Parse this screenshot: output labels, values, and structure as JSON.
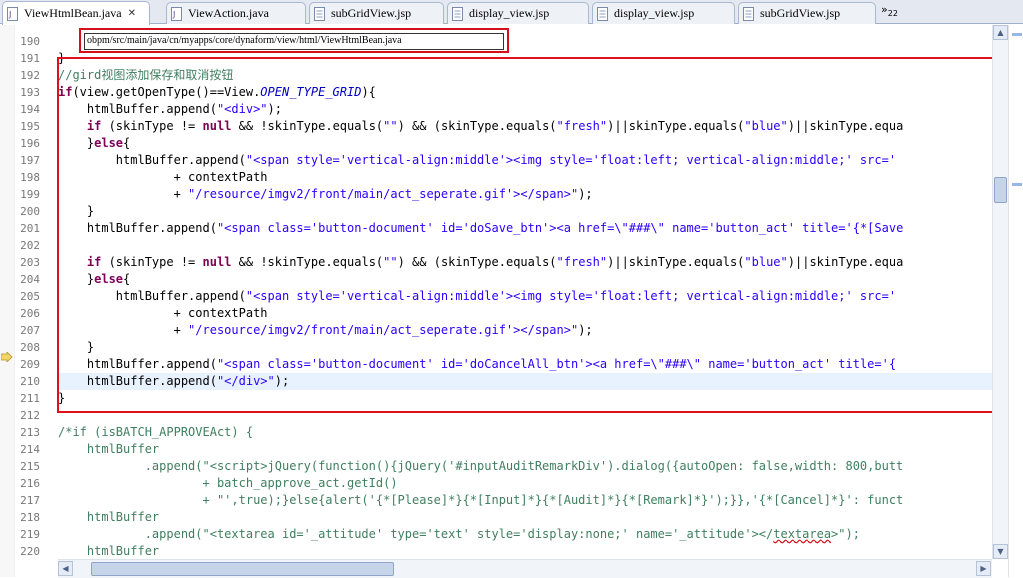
{
  "tabs": [
    {
      "label": "ViewHtmlBean.java",
      "active": true,
      "icon": "java-file-icon"
    },
    {
      "label": "ViewAction.java",
      "active": false,
      "icon": "java-file-icon"
    },
    {
      "label": "subGridView.jsp",
      "active": false,
      "icon": "jsp-file-icon"
    },
    {
      "label": "display_view.jsp",
      "active": false,
      "icon": "jsp-file-icon"
    },
    {
      "label": "display_view.jsp",
      "active": false,
      "icon": "jsp-file-icon"
    },
    {
      "label": "subGridView.jsp",
      "active": false,
      "icon": "jsp-file-icon"
    }
  ],
  "overflow": {
    "chevron": "»",
    "count": "22"
  },
  "file_path_tooltip": "obpm/src/main/java/cn/myapps/core/dynaform/view/html/ViewHtmlBean.java",
  "lines": [
    {
      "n": "190",
      "segs": []
    },
    {
      "n": "191",
      "segs": [
        {
          "t": "}"
        }
      ]
    },
    {
      "n": "192",
      "segs": [
        {
          "t": "//gird视图添加保存和取消按钮",
          "c": "cmt"
        }
      ]
    },
    {
      "n": "193",
      "segs": [
        {
          "t": "if",
          "c": "kw"
        },
        {
          "t": "(view.getOpenType()==View."
        },
        {
          "t": "OPEN_TYPE_GRID",
          "c": "ital"
        },
        {
          "t": "){"
        }
      ]
    },
    {
      "n": "194",
      "segs": [
        {
          "t": "    htmlBuffer.append("
        },
        {
          "t": "\"<div>\"",
          "c": "str"
        },
        {
          "t": ");"
        }
      ]
    },
    {
      "n": "195",
      "segs": [
        {
          "t": "    "
        },
        {
          "t": "if",
          "c": "kw"
        },
        {
          "t": " (skinType != "
        },
        {
          "t": "null",
          "c": "kw"
        },
        {
          "t": " && !skinType.equals("
        },
        {
          "t": "\"\"",
          "c": "str"
        },
        {
          "t": ") && (skinType.equals("
        },
        {
          "t": "\"fresh\"",
          "c": "str"
        },
        {
          "t": ")||skinType.equals("
        },
        {
          "t": "\"blue\"",
          "c": "str"
        },
        {
          "t": ")||skinType.equa"
        }
      ]
    },
    {
      "n": "196",
      "segs": [
        {
          "t": "    }"
        },
        {
          "t": "else",
          "c": "kw"
        },
        {
          "t": "{"
        }
      ]
    },
    {
      "n": "197",
      "segs": [
        {
          "t": "        htmlBuffer.append("
        },
        {
          "t": "\"<span style='vertical-align:middle'><img style='float:left; vertical-align:middle;' src='",
          "c": "str"
        }
      ]
    },
    {
      "n": "198",
      "segs": [
        {
          "t": "                + contextPath"
        }
      ]
    },
    {
      "n": "199",
      "segs": [
        {
          "t": "                + "
        },
        {
          "t": "\"/resource/imgv2/front/main/act_seperate.gif'></span>\"",
          "c": "str"
        },
        {
          "t": ");"
        }
      ]
    },
    {
      "n": "200",
      "segs": [
        {
          "t": "    }"
        }
      ]
    },
    {
      "n": "201",
      "segs": [
        {
          "t": "    htmlBuffer.append("
        },
        {
          "t": "\"<span class='button-document' id='doSave_btn'><a href=\\\"###\\\" name='button_act' title='{*[Save",
          "c": "str"
        }
      ]
    },
    {
      "n": "202",
      "segs": []
    },
    {
      "n": "203",
      "segs": [
        {
          "t": "    "
        },
        {
          "t": "if",
          "c": "kw"
        },
        {
          "t": " (skinType != "
        },
        {
          "t": "null",
          "c": "kw"
        },
        {
          "t": " && !skinType.equals("
        },
        {
          "t": "\"\"",
          "c": "str"
        },
        {
          "t": ") && (skinType.equals("
        },
        {
          "t": "\"fresh\"",
          "c": "str"
        },
        {
          "t": ")||skinType.equals("
        },
        {
          "t": "\"blue\"",
          "c": "str"
        },
        {
          "t": ")||skinType.equa"
        }
      ]
    },
    {
      "n": "204",
      "segs": [
        {
          "t": "    }"
        },
        {
          "t": "else",
          "c": "kw"
        },
        {
          "t": "{"
        }
      ]
    },
    {
      "n": "205",
      "segs": [
        {
          "t": "        htmlBuffer.append("
        },
        {
          "t": "\"<span style='vertical-align:middle'><img style='float:left; vertical-align:middle;' src='",
          "c": "str"
        }
      ]
    },
    {
      "n": "206",
      "segs": [
        {
          "t": "                + contextPath"
        }
      ]
    },
    {
      "n": "207",
      "segs": [
        {
          "t": "                + "
        },
        {
          "t": "\"/resource/imgv2/front/main/act_seperate.gif'></span>\"",
          "c": "str"
        },
        {
          "t": ");"
        }
      ]
    },
    {
      "n": "208",
      "segs": [
        {
          "t": "    }"
        }
      ]
    },
    {
      "n": "209",
      "segs": [
        {
          "t": "    htmlBuffer.append("
        },
        {
          "t": "\"<span class='button-document' id='doCancelAll_btn'><a href=\\\"###\\\" name='button_act' title='{",
          "c": "str"
        }
      ]
    },
    {
      "n": "210",
      "segs": [
        {
          "t": "    htmlBuffer.append("
        },
        {
          "t": "\"</div>\"",
          "c": "str"
        },
        {
          "t": ");"
        }
      ]
    },
    {
      "n": "211",
      "segs": [
        {
          "t": "}"
        }
      ]
    },
    {
      "n": "212",
      "segs": []
    },
    {
      "n": "213",
      "segs": [
        {
          "t": "/*if (isBATCH_APPROVEAct) {",
          "c": "cmt"
        }
      ]
    },
    {
      "n": "214",
      "segs": [
        {
          "t": "    htmlBuffer",
          "c": "cmt"
        }
      ]
    },
    {
      "n": "215",
      "segs": [
        {
          "t": "            .append(\"<script>jQuery(function(){jQuery('#inputAuditRemarkDiv').dialog({autoOpen: false,width: 800,butt",
          "c": "cmt"
        }
      ]
    },
    {
      "n": "216",
      "segs": [
        {
          "t": "                    + batch_approve_act.getId()",
          "c": "cmt"
        }
      ]
    },
    {
      "n": "217",
      "segs": [
        {
          "t": "                    + \"',true);}else{alert('{*[Please]*}{*[Input]*}{*[Audit]*}{*[Remark]*}');}},'{*[Cancel]*}': funct",
          "c": "cmt"
        }
      ]
    },
    {
      "n": "218",
      "segs": [
        {
          "t": "    htmlBuffer",
          "c": "cmt"
        }
      ]
    },
    {
      "n": "219",
      "segs": [
        {
          "t": "            .append(\"<textarea id='_attitude' type='text' style='display:none;' name='_attitude'></",
          "c": "cmt"
        },
        {
          "t": "textarea",
          "c": "cmt squiggle"
        },
        {
          "t": ">\");",
          "c": "cmt"
        }
      ]
    },
    {
      "n": "220",
      "segs": [
        {
          "t": "    htmlBuffer",
          "c": "cmt"
        }
      ]
    }
  ],
  "current_line": "210",
  "colors": {
    "keyword": "#7f0055",
    "string": "#2a00ff",
    "comment": "#3f7f5f",
    "annotation_box": "#e0101a",
    "current_line_bg": "#e8f2fe"
  }
}
